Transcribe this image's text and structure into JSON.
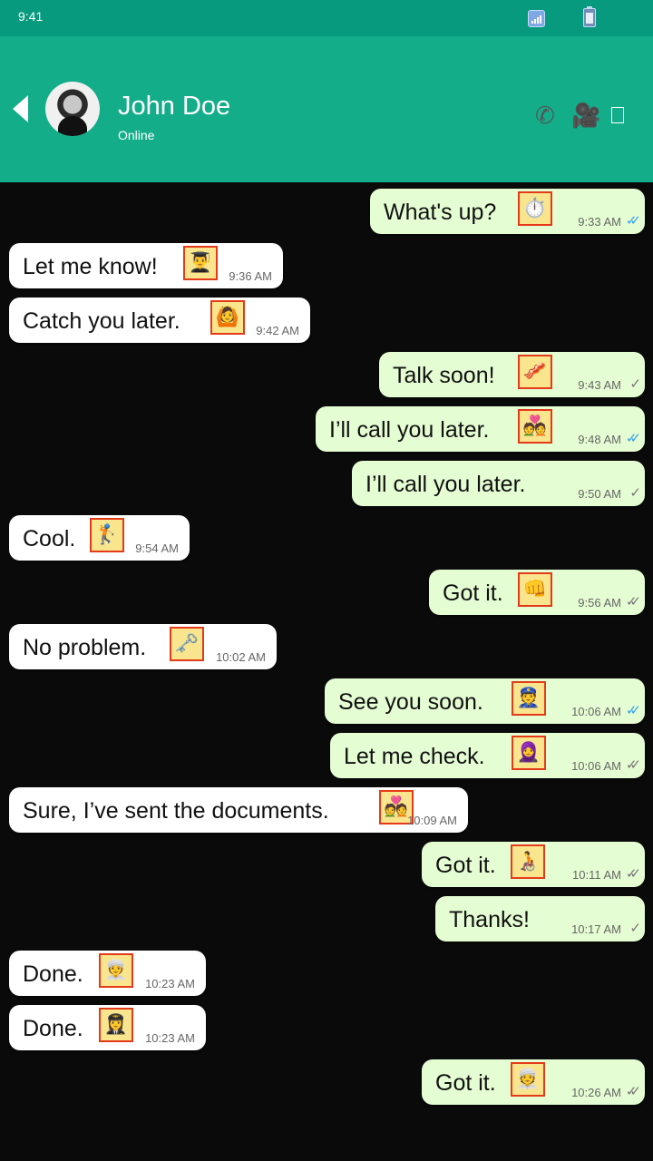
{
  "status_bar": {
    "time": "9:41"
  },
  "header": {
    "contact_name": "John Doe",
    "presence": "Online"
  },
  "messages": [
    {
      "dir": "out",
      "text": "What's up?",
      "emoji": "⏱️",
      "time": "9:33 AM",
      "ticks": "read"
    },
    {
      "dir": "in",
      "text": "Let me know!",
      "emoji": "👨‍🎓",
      "time": "9:36 AM"
    },
    {
      "dir": "in",
      "text": "Catch you later.",
      "emoji": "🙆",
      "time": "9:42 AM"
    },
    {
      "dir": "out",
      "text": "Talk soon!",
      "emoji": "🥓",
      "time": "9:43 AM",
      "ticks": "sent"
    },
    {
      "dir": "out",
      "text": "I’ll call you later.",
      "emoji": "💑",
      "time": "9:48 AM",
      "ticks": "read"
    },
    {
      "dir": "out",
      "text": "I’ll call you later.",
      "emoji": "",
      "time": "9:50 AM",
      "ticks": "sent"
    },
    {
      "dir": "in",
      "text": "Cool.",
      "emoji": "🏌️",
      "time": "9:54 AM"
    },
    {
      "dir": "out",
      "text": "Got it.",
      "emoji": "👊",
      "time": "9:56 AM",
      "ticks": "delivered"
    },
    {
      "dir": "in",
      "text": "No problem.",
      "emoji": "🗝️",
      "time": "10:02 AM"
    },
    {
      "dir": "out",
      "text": "See you soon.",
      "emoji": "👮",
      "time": "10:06 AM",
      "ticks": "read"
    },
    {
      "dir": "out",
      "text": "Let me check.",
      "emoji": "🧕",
      "time": "10:06 AM",
      "ticks": "delivered"
    },
    {
      "dir": "in",
      "text": "Sure, I’ve sent the documents.",
      "emoji": "💑",
      "time": "10:09 AM"
    },
    {
      "dir": "out",
      "text": "Got it.",
      "emoji": "🧑‍🦽",
      "time": "10:11 AM",
      "ticks": "delivered"
    },
    {
      "dir": "out",
      "text": "Thanks!",
      "emoji": "",
      "time": "10:17 AM",
      "ticks": "sent"
    },
    {
      "dir": "in",
      "text": "Done.",
      "emoji": "👳‍♀️",
      "time": "10:23 AM"
    },
    {
      "dir": "in",
      "text": "Done.",
      "emoji": "👩‍✈️",
      "time": "10:23 AM"
    },
    {
      "dir": "out",
      "text": "Got it.",
      "emoji": "👳",
      "time": "10:26 AM",
      "ticks": "delivered"
    }
  ],
  "colors": {
    "header": "#13ad8a",
    "status_bar": "#079a7e",
    "incoming": "#ffffff",
    "outgoing": "#e5fdd3",
    "read_ticks": "#3aa0f0"
  },
  "icons": [
    "back-arrow-icon",
    "phone-icon",
    "video-camera-icon",
    "menu-icon",
    "signal-icon",
    "battery-icon"
  ]
}
